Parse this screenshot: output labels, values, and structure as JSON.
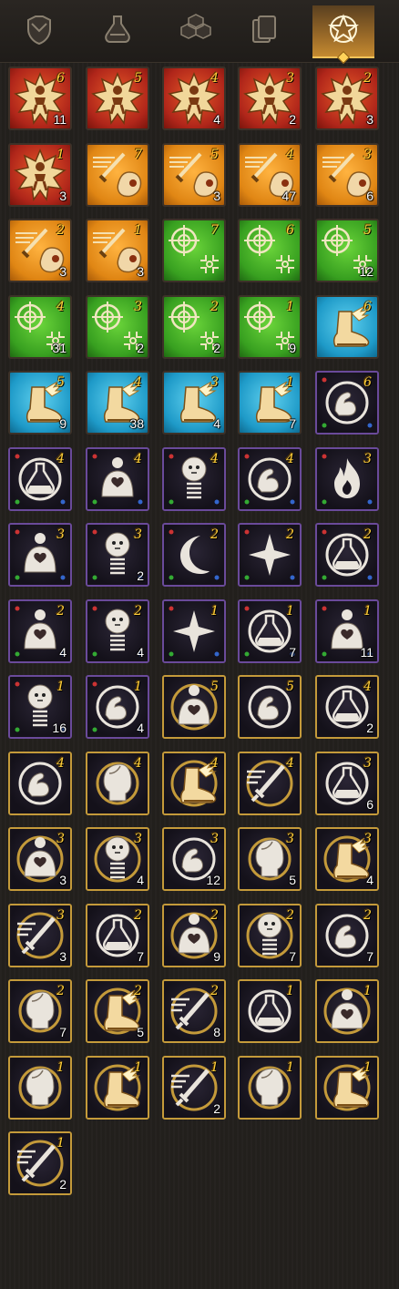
{
  "tabs": [
    {
      "icon": "armor-icon",
      "active": false
    },
    {
      "icon": "potion-icon",
      "active": false
    },
    {
      "icon": "materials-icon",
      "active": false
    },
    {
      "icon": "cards-icon",
      "active": false
    },
    {
      "icon": "star-emblem-icon",
      "active": true
    }
  ],
  "colors": {
    "red": "#c02a1a",
    "orange": "#e08614",
    "green": "#38a020",
    "blue": "#1e9ac8",
    "purple_frame": "#6a4a9a",
    "gold_frame": "#c49a3a",
    "level_text": "#ffcf3a"
  },
  "items": [
    {
      "type": "red-rune",
      "icon": "starburst-figure-icon",
      "level": "6",
      "count": "11"
    },
    {
      "type": "red-rune",
      "icon": "starburst-figure-icon",
      "level": "5",
      "count": ""
    },
    {
      "type": "red-rune",
      "icon": "starburst-figure-icon",
      "level": "4",
      "count": "4"
    },
    {
      "type": "red-rune",
      "icon": "starburst-figure-icon",
      "level": "3",
      "count": "2"
    },
    {
      "type": "red-rune",
      "icon": "starburst-figure-icon",
      "level": "2",
      "count": "3"
    },
    {
      "type": "red-rune",
      "icon": "starburst-figure-icon",
      "level": "1",
      "count": "3"
    },
    {
      "type": "orange-rune",
      "icon": "sword-head-icon",
      "level": "7",
      "count": ""
    },
    {
      "type": "orange-rune",
      "icon": "sword-head-icon",
      "level": "5",
      "count": "3"
    },
    {
      "type": "orange-rune",
      "icon": "sword-head-icon",
      "level": "4",
      "count": "47"
    },
    {
      "type": "orange-rune",
      "icon": "sword-head-icon",
      "level": "3",
      "count": "6"
    },
    {
      "type": "orange-rune",
      "icon": "sword-head-icon",
      "level": "2",
      "count": "3"
    },
    {
      "type": "orange-rune",
      "icon": "sword-head-icon",
      "level": "1",
      "count": "3"
    },
    {
      "type": "green-rune",
      "icon": "crosshair-icon",
      "level": "7",
      "count": ""
    },
    {
      "type": "green-rune",
      "icon": "crosshair-icon",
      "level": "6",
      "count": ""
    },
    {
      "type": "green-rune",
      "icon": "crosshair-icon",
      "level": "5",
      "count": "12"
    },
    {
      "type": "green-rune",
      "icon": "crosshair-icon",
      "level": "4",
      "count": "31"
    },
    {
      "type": "green-rune",
      "icon": "crosshair-icon",
      "level": "3",
      "count": "2"
    },
    {
      "type": "green-rune",
      "icon": "crosshair-icon",
      "level": "2",
      "count": "2"
    },
    {
      "type": "green-rune",
      "icon": "crosshair-icon",
      "level": "1",
      "count": "9"
    },
    {
      "type": "blue-rune",
      "icon": "winged-boot-icon",
      "level": "6",
      "count": ""
    },
    {
      "type": "blue-rune",
      "icon": "winged-boot-icon",
      "level": "5",
      "count": "9"
    },
    {
      "type": "blue-rune",
      "icon": "winged-boot-icon",
      "level": "4",
      "count": "38"
    },
    {
      "type": "blue-rune",
      "icon": "winged-boot-icon",
      "level": "3",
      "count": "4"
    },
    {
      "type": "blue-rune",
      "icon": "winged-boot-icon",
      "level": "1",
      "count": "7"
    },
    {
      "type": "purple-socket",
      "icon": "flexed-arm-icon",
      "level": "6",
      "count": ""
    },
    {
      "type": "purple-socket",
      "icon": "flask-icon",
      "level": "4",
      "count": ""
    },
    {
      "type": "purple-socket",
      "icon": "heart-body-icon",
      "level": "4",
      "count": ""
    },
    {
      "type": "purple-socket",
      "icon": "spring-head-icon",
      "level": "4",
      "count": ""
    },
    {
      "type": "purple-socket",
      "icon": "flexed-arm-icon",
      "level": "4",
      "count": ""
    },
    {
      "type": "purple-socket",
      "icon": "flame-icon",
      "level": "3",
      "count": ""
    },
    {
      "type": "purple-socket",
      "icon": "heart-body-icon",
      "level": "3",
      "count": ""
    },
    {
      "type": "purple-socket",
      "icon": "spring-head-icon",
      "level": "3",
      "count": "2"
    },
    {
      "type": "purple-socket",
      "icon": "crescent-moon-icon",
      "level": "2",
      "count": ""
    },
    {
      "type": "purple-socket",
      "icon": "four-point-star-icon",
      "level": "2",
      "count": ""
    },
    {
      "type": "purple-socket",
      "icon": "flask-icon",
      "level": "2",
      "count": ""
    },
    {
      "type": "purple-socket",
      "icon": "heart-body-icon",
      "level": "2",
      "count": "4"
    },
    {
      "type": "purple-socket",
      "icon": "spring-head-icon",
      "level": "2",
      "count": "4"
    },
    {
      "type": "purple-socket",
      "icon": "four-point-star-icon",
      "level": "1",
      "count": ""
    },
    {
      "type": "purple-socket",
      "icon": "flask-icon",
      "level": "1",
      "count": "7"
    },
    {
      "type": "purple-socket",
      "icon": "heart-body-icon",
      "level": "1",
      "count": "11"
    },
    {
      "type": "purple-socket",
      "icon": "spring-head-icon",
      "level": "1",
      "count": "16"
    },
    {
      "type": "purple-socket",
      "icon": "flexed-arm-icon",
      "level": "1",
      "count": "4"
    },
    {
      "type": "gold-ring",
      "icon": "heart-body-icon",
      "level": "5",
      "count": ""
    },
    {
      "type": "gold-ring",
      "icon": "flexed-arm-icon",
      "level": "5",
      "count": ""
    },
    {
      "type": "gold-ring",
      "icon": "flask-icon",
      "level": "4",
      "count": "2"
    },
    {
      "type": "gold-ring",
      "icon": "flexed-arm-icon",
      "level": "4",
      "count": ""
    },
    {
      "type": "gold-ring",
      "icon": "bust-head-icon",
      "level": "4",
      "count": ""
    },
    {
      "type": "gold-ring",
      "icon": "winged-boot-icon",
      "level": "4",
      "count": ""
    },
    {
      "type": "gold-ring",
      "icon": "sword-icon",
      "level": "4",
      "count": ""
    },
    {
      "type": "gold-ring",
      "icon": "flask-icon",
      "level": "3",
      "count": "6"
    },
    {
      "type": "gold-ring",
      "icon": "heart-body-icon",
      "level": "3",
      "count": "3"
    },
    {
      "type": "gold-ring",
      "icon": "spring-head-icon",
      "level": "3",
      "count": "4"
    },
    {
      "type": "gold-ring",
      "icon": "flexed-arm-icon",
      "level": "3",
      "count": "12"
    },
    {
      "type": "gold-ring",
      "icon": "bust-head-icon",
      "level": "3",
      "count": "5"
    },
    {
      "type": "gold-ring",
      "icon": "winged-boot-icon",
      "level": "3",
      "count": "4"
    },
    {
      "type": "gold-ring",
      "icon": "sword-icon",
      "level": "3",
      "count": "3"
    },
    {
      "type": "gold-ring",
      "icon": "flask-icon",
      "level": "2",
      "count": "7"
    },
    {
      "type": "gold-ring",
      "icon": "heart-body-icon",
      "level": "2",
      "count": "9"
    },
    {
      "type": "gold-ring",
      "icon": "spring-head-icon",
      "level": "2",
      "count": "7"
    },
    {
      "type": "gold-ring",
      "icon": "flexed-arm-icon",
      "level": "2",
      "count": "7"
    },
    {
      "type": "gold-ring",
      "icon": "bust-head-icon",
      "level": "2",
      "count": "7"
    },
    {
      "type": "gold-ring",
      "icon": "winged-boot-icon",
      "level": "2",
      "count": "5"
    },
    {
      "type": "gold-ring",
      "icon": "sword-icon",
      "level": "2",
      "count": "8"
    },
    {
      "type": "gold-ring",
      "icon": "flask-icon",
      "level": "1",
      "count": ""
    },
    {
      "type": "gold-ring",
      "icon": "heart-body-icon",
      "level": "1",
      "count": ""
    },
    {
      "type": "gold-ring",
      "icon": "bust-head-icon",
      "level": "1",
      "count": ""
    },
    {
      "type": "gold-ring",
      "icon": "winged-boot-icon",
      "level": "1",
      "count": ""
    },
    {
      "type": "gold-ring",
      "icon": "sword-icon",
      "level": "1",
      "count": "2"
    },
    {
      "type": "gold-ring",
      "icon": "bust-head-icon",
      "level": "1",
      "count": ""
    },
    {
      "type": "gold-ring",
      "icon": "winged-boot-icon",
      "level": "1",
      "count": ""
    },
    {
      "type": "gold-ring",
      "icon": "sword-icon",
      "level": "1",
      "count": "2"
    }
  ]
}
